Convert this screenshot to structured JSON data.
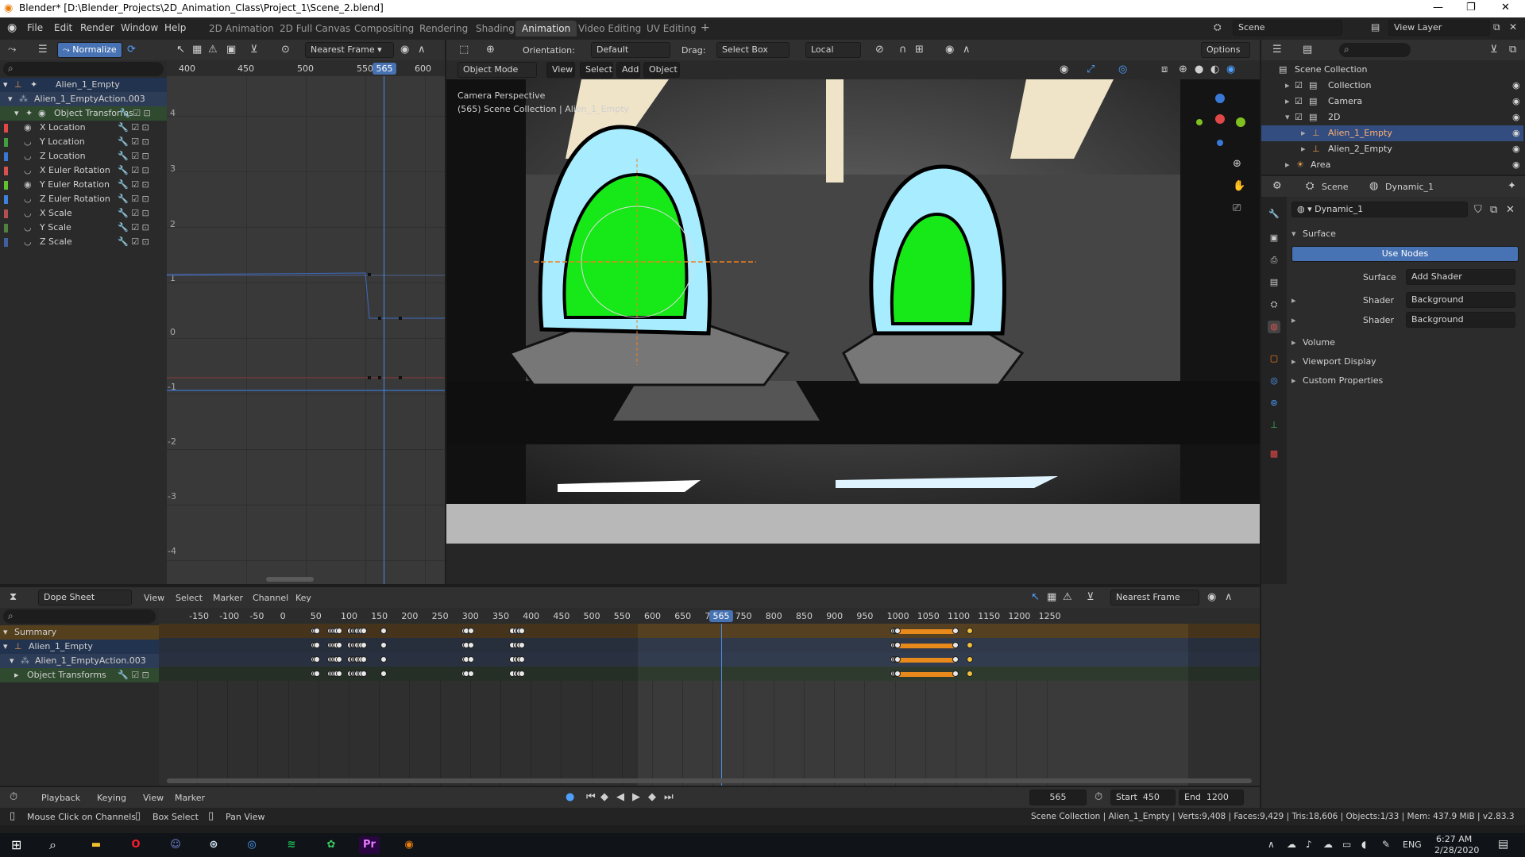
{
  "window": {
    "title": "Blender* [D:\\Blender_Projects\\2D_Animation_Class\\Project_1\\Scene_2.blend]"
  },
  "menu": [
    "File",
    "Edit",
    "Render",
    "Window",
    "Help"
  ],
  "workspaces": [
    "2D Animation",
    "2D Full Canvas",
    "Compositing",
    "Rendering",
    "Shading",
    "Animation",
    "Video Editing",
    "UV Editing"
  ],
  "active_workspace": "Animation",
  "top_right": {
    "scene": "Scene",
    "view_layer": "View Layer"
  },
  "graph_editor": {
    "normalize": "Normalize",
    "snap": "Nearest Frame",
    "frame_ticks": [
      "400",
      "450",
      "500",
      "550",
      "600"
    ],
    "current_frame": "565",
    "value_ticks": [
      "4",
      "3",
      "2",
      "1",
      "0",
      "-1",
      "-2",
      "-3",
      "-4"
    ],
    "channels": [
      {
        "name": "Alien_1_Empty",
        "type": "object"
      },
      {
        "name": "Alien_1_EmptyAction.003",
        "type": "action"
      },
      {
        "name": "Object Transforms",
        "type": "group"
      },
      {
        "name": "X Location",
        "color": "#e04848"
      },
      {
        "name": "Y Location",
        "color": "#40a040"
      },
      {
        "name": "Z Location",
        "color": "#3a78d8"
      },
      {
        "name": "X Euler Rotation",
        "color": "#d85050"
      },
      {
        "name": "Y Euler Rotation",
        "color": "#60c030"
      },
      {
        "name": "Z Euler Rotation",
        "color": "#4080e0"
      },
      {
        "name": "X Scale",
        "color": "#b05050"
      },
      {
        "name": "Y Scale",
        "color": "#508040"
      },
      {
        "name": "Z Scale",
        "color": "#4060a0"
      }
    ]
  },
  "viewport": {
    "mode": "Object Mode",
    "menus": [
      "View",
      "Select",
      "Add",
      "Object"
    ],
    "orientation_label": "Orientation:",
    "orientation": "Default",
    "drag_label": "Drag:",
    "drag": "Select Box",
    "pivot": "Local",
    "options": "Options",
    "overlay_title": "Camera Perspective",
    "overlay_sub": "(565) Scene Collection | Alien_1_Empty"
  },
  "outliner": {
    "title": "Scene Collection",
    "items": [
      "Collection",
      "Camera",
      "2D",
      "Alien_1_Empty",
      "Alien_2_Empty",
      "Area"
    ],
    "selected": "Alien_1_Empty"
  },
  "properties": {
    "tabs": [
      "Scene",
      "Dynamic_1"
    ],
    "world": "Dynamic_1",
    "section_surface": "Surface",
    "use_nodes": "Use Nodes",
    "surface_label": "Surface",
    "surface_value": "Add Shader",
    "shader_label": "Shader",
    "shader_1": "Background",
    "shader_2": "Background",
    "collapsed": [
      "Volume",
      "Viewport Display",
      "Custom Properties"
    ]
  },
  "dopesheet": {
    "mode": "Dope Sheet",
    "menus": [
      "View",
      "Select",
      "Marker",
      "Channel",
      "Key"
    ],
    "snap": "Nearest Frame",
    "ticks": [
      "-150",
      "-100",
      "-50",
      "0",
      "50",
      "100",
      "150",
      "200",
      "250",
      "300",
      "350",
      "400",
      "450",
      "500",
      "550",
      "600",
      "650",
      "700",
      "750",
      "800",
      "850",
      "900",
      "950",
      "1000",
      "1050",
      "1100",
      "1150",
      "1200",
      "1250"
    ],
    "current_frame": "565",
    "channels": [
      "Summary",
      "Alien_1_Empty",
      "Alien_1_EmptyAction.003",
      "Object Transforms"
    ],
    "keyframes": [
      42,
      45,
      47,
      70,
      73,
      75,
      78,
      80,
      84,
      102,
      106,
      108,
      110,
      113,
      115,
      118,
      121,
      125,
      158,
      291,
      294,
      301,
      370,
      376,
      380,
      382,
      385,
      998,
      1001,
      1003,
      1005,
      1100,
      1124
    ],
    "hold_range": [
      1005,
      1100
    ]
  },
  "timeline": {
    "menus": [
      "Playback",
      "Keying",
      "View",
      "Marker"
    ],
    "current_frame": "565",
    "start_label": "Start",
    "start": "450",
    "end_label": "End",
    "end": "1200"
  },
  "statusbar": {
    "hint_1": "Mouse Click on Channels",
    "hint_2": "Box Select",
    "hint_3": "Pan View",
    "stats": "Scene Collection | Alien_1_Empty | Verts:9,408 | Faces:9,429 | Tris:18,606 | Objects:1/33 | Mem: 437.9 MiB | v2.83.3"
  },
  "taskbar": {
    "lang": "ENG",
    "time": "6:27 AM",
    "date": "2/28/2020",
    "apps": [
      "file-explorer",
      "opera",
      "discord",
      "steam",
      "chrome",
      "spotify",
      "krita",
      "premiere",
      "blender"
    ]
  }
}
